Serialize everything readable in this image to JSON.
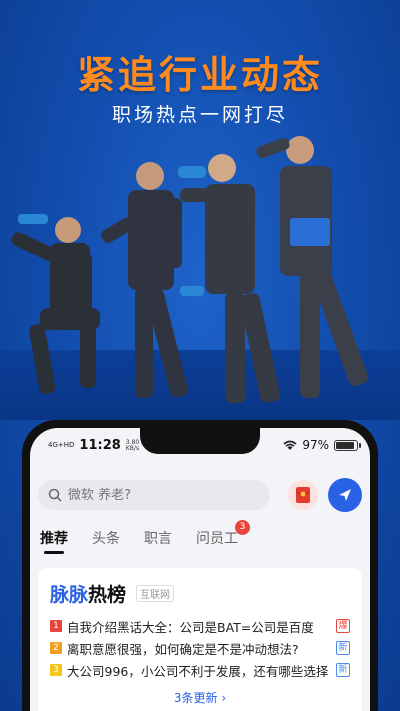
{
  "banner": {
    "headline": "紧追行业动态",
    "subheadline": "职场热点一网打尽"
  },
  "status_bar": {
    "network": "4G+HD",
    "time": "11:28",
    "speed_value": "3.80",
    "speed_unit": "KB/s",
    "battery": "97%",
    "battery_level": 0.97
  },
  "search": {
    "placeholder": "微软 养老?"
  },
  "tabs": [
    {
      "label": "推荐",
      "active": true
    },
    {
      "label": "头条",
      "active": false
    },
    {
      "label": "职言",
      "active": false
    },
    {
      "label": "问员工",
      "active": false,
      "badge": "3"
    }
  ],
  "hot_list": {
    "title_part1": "脉脉",
    "title_part2": "热榜",
    "tag": "互联网",
    "items": [
      {
        "rank": "1",
        "text": "自我介绍黑话大全：公司是BAT=公司是百度",
        "flag": "爆",
        "rank_color": "#e8453c",
        "flag_color": "#e8453c"
      },
      {
        "rank": "2",
        "text": "离职意愿很强，如何确定是不是冲动想法?",
        "flag": "新",
        "rank_color": "#f0a020",
        "flag_color": "#4a8cf0"
      },
      {
        "rank": "3",
        "text": "大公司996，小公司不利于发展，还有哪些选择",
        "flag": "新",
        "rank_color": "#f2c618",
        "flag_color": "#4a8cf0"
      }
    ],
    "more": "3条更新 ›"
  },
  "colors": {
    "accent": "#2a62e6",
    "headline": "#ff8a1e",
    "background": "#134fb0"
  }
}
